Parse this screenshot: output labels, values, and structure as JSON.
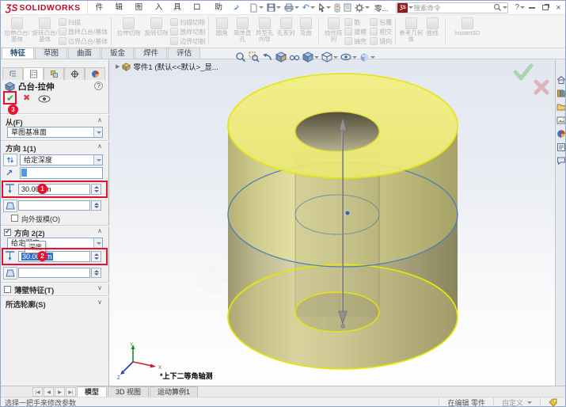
{
  "colors": {
    "annotation_red": "#e8112d",
    "preview_yellow": "#f0ed7a",
    "edge_yellow": "#e6e80e",
    "sketch_blue": "#4a7fb0",
    "body_olive": "#b3ae8f",
    "check_green": "#43a047",
    "cross_red": "#cc4444"
  },
  "title_bar": {
    "logo_mark": "ƷS",
    "logo_text": "SOLIDWORKS",
    "menus": [
      "文件(F)",
      "编辑(E)",
      "视图(V)",
      "插入(I)",
      "工具(T)",
      "窗口(W)",
      "帮助(H)"
    ],
    "doc_short": "零...",
    "search_placeholder": "搜索命令"
  },
  "ribbon": {
    "g1": {
      "b1": "拉伸凸台/基体",
      "b2": "旋转凸台/基体",
      "s1": "扫描",
      "s2": "放样凸台/基体",
      "s3": "边界凸台/基体"
    },
    "g2": {
      "b1": "拉伸切除",
      "b2": "旋转切除",
      "s1": "扫描切除",
      "s2": "放样切割",
      "s3": "边界切割"
    },
    "g3": {
      "b1": "圆角",
      "b2": "简单直孔",
      "b3": "异型孔向导",
      "b4": "孔系列",
      "b5": "弯曲"
    },
    "g4": {
      "b1": "线性阵列",
      "s1": "筋",
      "s2": "拔模",
      "s3": "抽壳",
      "t1": "包覆",
      "t2": "相交",
      "t3": "镜向"
    },
    "g5": {
      "b1": "参考几何体",
      "b2": "曲线"
    },
    "g6": {
      "b1": "Instant3D"
    }
  },
  "doc_tabs": [
    "特征",
    "草图",
    "曲面",
    "钣金",
    "焊件",
    "评估"
  ],
  "tree_root": "零件1 (默认<<默认>_显...",
  "pm": {
    "title": "凸台-拉伸",
    "from_label": "从(F)",
    "from_value": "草图基准面",
    "dir1_label": "方向 1(1)",
    "dir1_condition": "给定深度",
    "dir1_depth": "30.00mm",
    "dir1_draft_option": "向外拔模(O)",
    "dir2_label": "方向 2(2)",
    "dir2_condition": "给定深度",
    "dir2_tooltip": "深度",
    "dir2_depth": "30.00mm",
    "thin_label": "薄壁特征(T)",
    "profiles_label": "所选轮廓(S)",
    "badge1": "1",
    "badge2": "2",
    "badge3": "3"
  },
  "viewport": {
    "view_label": "*上下二等角轴测",
    "watermark_cn": "软件自学网",
    "watermark_en": "WWW.RJZXW.COM",
    "axis_x": "X",
    "axis_y": "Y",
    "axis_z": "Z"
  },
  "bottom": {
    "nav": [
      "|◀",
      "◀",
      "▶",
      "▶|"
    ],
    "tabs": [
      "模型",
      "3D 视图",
      "运动算例1"
    ],
    "status_message": "选择一把手来修改参数",
    "editing_label": "在编辑 零件",
    "custom_label": "自定义"
  },
  "glyphs": {
    "chev_up": "∧",
    "chev_down": "∨",
    "check": "✔",
    "cross": "✖",
    "flyout": "▶",
    "dir_arrow": "↗",
    "undo": "↶",
    "help": "?"
  }
}
